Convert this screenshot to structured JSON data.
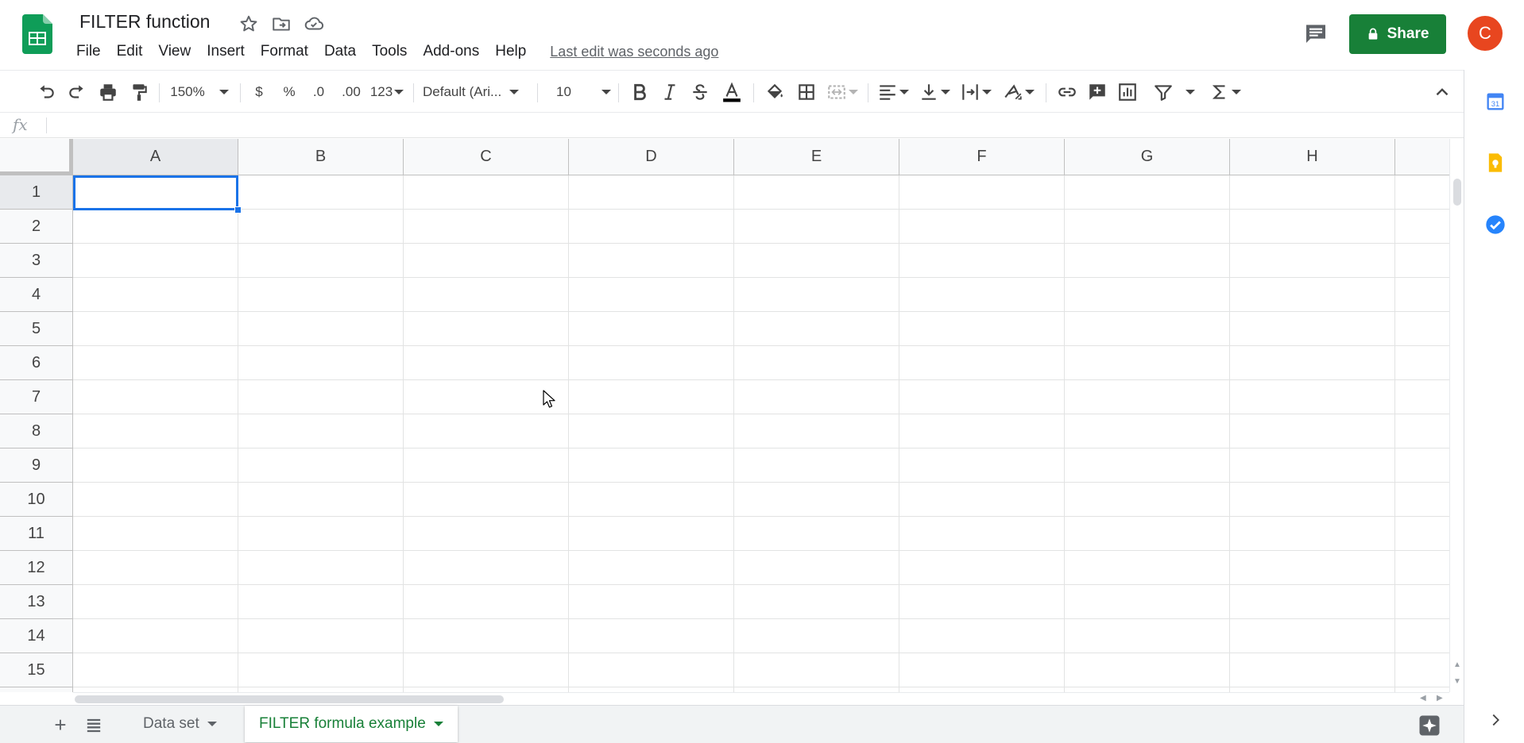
{
  "doc": {
    "title": "FILTER function",
    "last_edit": "Last edit was seconds ago"
  },
  "menu": [
    "File",
    "Edit",
    "View",
    "Insert",
    "Format",
    "Data",
    "Tools",
    "Add-ons",
    "Help"
  ],
  "share": {
    "label": "Share"
  },
  "user": {
    "avatar_letter": "C",
    "avatar_color": "#e8461f"
  },
  "toolbar": {
    "zoom": "150%",
    "currency": "$",
    "percent": "%",
    "decrease_decimals": ".0",
    "increase_decimals": ".00",
    "more_formats": "123",
    "font_family": "Default (Ari...",
    "font_size": "10"
  },
  "formula_bar": {
    "fx_label": "fx",
    "value": ""
  },
  "columns": [
    "A",
    "B",
    "C",
    "D",
    "E",
    "F",
    "G",
    "H"
  ],
  "rows": [
    "1",
    "2",
    "3",
    "4",
    "5",
    "6",
    "7",
    "8",
    "9",
    "10",
    "11",
    "12",
    "13",
    "14",
    "15"
  ],
  "selection": {
    "cell": "A1"
  },
  "sheets": [
    {
      "name": "Data set",
      "active": false
    },
    {
      "name": "FILTER formula example",
      "active": true
    }
  ],
  "colors": {
    "brand_green": "#188038",
    "selection_blue": "#1a73e8",
    "sheets_logo_green": "#0f9d58"
  },
  "icons": {
    "topbar": [
      "sheets-logo-icon",
      "star-icon",
      "move-to-folder-icon",
      "cloud-saved-icon",
      "comments-icon",
      "lock-icon"
    ],
    "side_panel": [
      "calendar-icon",
      "keep-icon",
      "tasks-icon",
      "chevron-right-icon"
    ]
  }
}
